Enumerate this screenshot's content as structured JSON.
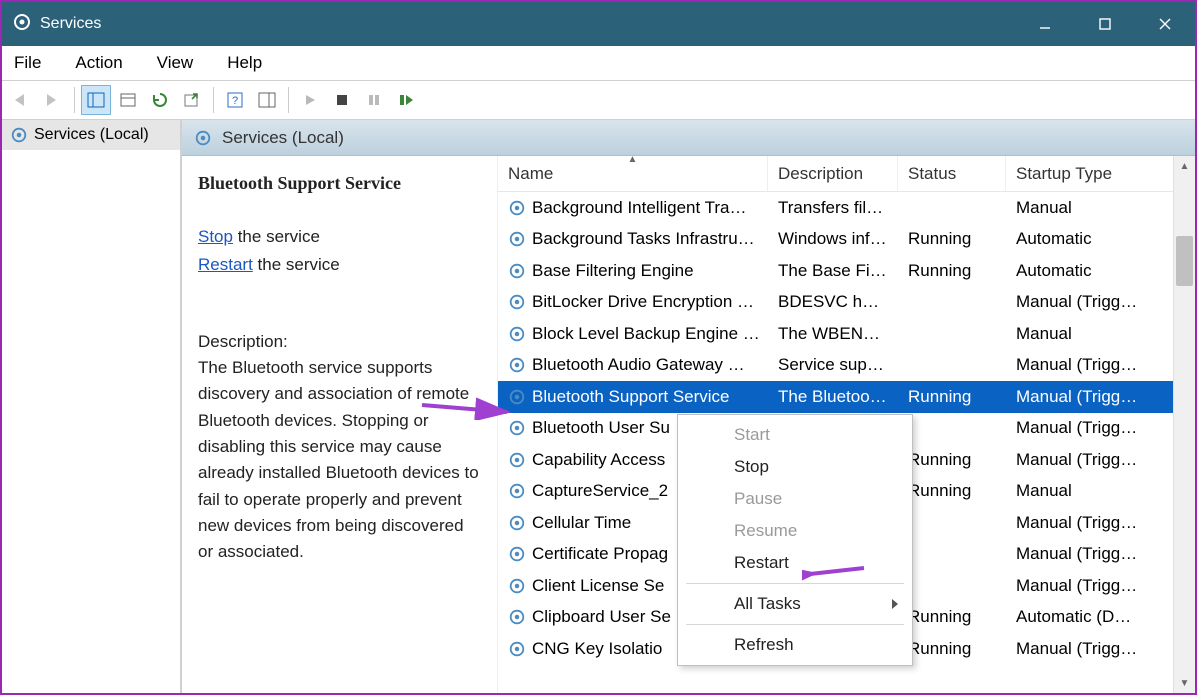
{
  "titlebar": {
    "title": "Services"
  },
  "menubar": [
    "File",
    "Action",
    "View",
    "Help"
  ],
  "tree": {
    "root_label": "Services (Local)"
  },
  "panel": {
    "heading": "Services (Local)"
  },
  "detail": {
    "service_name": "Bluetooth Support Service",
    "stop_label": "Stop",
    "stop_tail": " the service",
    "restart_label": "Restart",
    "restart_tail": " the service",
    "desc_header": "Description:",
    "description": "The Bluetooth service supports discovery and association of remote Bluetooth devices. Stopping or disabling this service may cause already installed Bluetooth devices to fail to operate properly and prevent new devices from being discovered or associated."
  },
  "columns": {
    "name": "Name",
    "description": "Description",
    "status": "Status",
    "startup": "Startup Type"
  },
  "rows": [
    {
      "name": "Background Intelligent Tra…",
      "desc": "Transfers file…",
      "status": "",
      "startup": "Manual"
    },
    {
      "name": "Background Tasks Infrastru…",
      "desc": "Windows inf…",
      "status": "Running",
      "startup": "Automatic"
    },
    {
      "name": "Base Filtering Engine",
      "desc": "The Base Filt…",
      "status": "Running",
      "startup": "Automatic"
    },
    {
      "name": "BitLocker Drive Encryption …",
      "desc": "BDESVC hos…",
      "status": "",
      "startup": "Manual (Trigg…"
    },
    {
      "name": "Block Level Backup Engine …",
      "desc": "The WBENG…",
      "status": "",
      "startup": "Manual"
    },
    {
      "name": "Bluetooth Audio Gateway …",
      "desc": "Service supp…",
      "status": "",
      "startup": "Manual (Trigg…"
    },
    {
      "name": "Bluetooth Support Service",
      "desc": "The Bluetoo…",
      "status": "Running",
      "startup": "Manual (Trigg…",
      "selected": true
    },
    {
      "name": "Bluetooth User Su",
      "desc": "",
      "status": "",
      "startup": "Manual (Trigg…"
    },
    {
      "name": "Capability Access",
      "desc": "",
      "status": "Running",
      "startup": "Manual (Trigg…"
    },
    {
      "name": "CaptureService_2",
      "desc": "",
      "status": "Running",
      "startup": "Manual"
    },
    {
      "name": "Cellular Time",
      "desc": "",
      "status": "",
      "startup": "Manual (Trigg…"
    },
    {
      "name": "Certificate Propag",
      "desc": "",
      "status": "",
      "startup": "Manual (Trigg…"
    },
    {
      "name": "Client License Se",
      "desc": "",
      "status": "",
      "startup": "Manual (Trigg…"
    },
    {
      "name": "Clipboard User Se",
      "desc": "",
      "status": "Running",
      "startup": "Automatic (D…"
    },
    {
      "name": "CNG Key Isolatio",
      "desc": "",
      "status": "Running",
      "startup": "Manual (Trigg…"
    }
  ],
  "context_menu": {
    "start": "Start",
    "stop": "Stop",
    "pause": "Pause",
    "resume": "Resume",
    "restart": "Restart",
    "all_tasks": "All Tasks",
    "refresh": "Refresh"
  }
}
